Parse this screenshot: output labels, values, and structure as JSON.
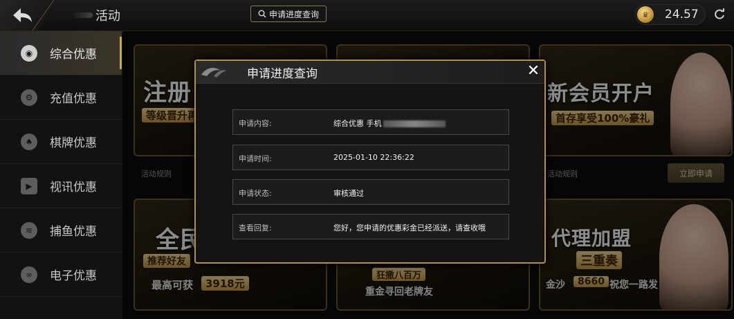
{
  "header": {
    "title": "活动",
    "query_button": "申请进度查询",
    "balance": "24.57"
  },
  "sidebar": {
    "items": [
      {
        "label": "综合优惠",
        "icon": "gift-icon",
        "active": true
      },
      {
        "label": "充值优惠",
        "icon": "recharge-icon",
        "active": false
      },
      {
        "label": "棋牌优惠",
        "icon": "cards-icon",
        "active": false
      },
      {
        "label": "视讯优惠",
        "icon": "video-icon",
        "active": false
      },
      {
        "label": "捕鱼优惠",
        "icon": "fish-icon",
        "active": false
      },
      {
        "label": "电子优惠",
        "icon": "slot-icon",
        "active": false
      }
    ]
  },
  "cards": [
    {
      "title": "注册",
      "band": "等级晋升再"
    },
    {
      "title": "",
      "band": ""
    },
    {
      "title": "新会员开户",
      "band": "首存享受100%豪礼"
    },
    {
      "title": "全民",
      "band": "推荐好友",
      "extra": "最高可获",
      "amount": "3918元"
    },
    {
      "title": "狂撒八百万",
      "band": "重金寻回老牌友"
    },
    {
      "title": "代理加盟",
      "band": "三重奏",
      "extra": "金沙",
      "amount": "8660",
      "extra2": "祝您一路发"
    }
  ],
  "rules_label": "活动规则",
  "apply_button": "立即申请",
  "modal": {
    "title": "申请进度查询",
    "rows": [
      {
        "label": "申请内容:",
        "value": "综合优惠 手机"
      },
      {
        "label": "申请时间:",
        "value": "2025-01-10 22:36:22"
      },
      {
        "label": "申请状态:",
        "value": "审核通过"
      },
      {
        "label": "查看回复:",
        "value": "您好，您申请的优惠彩金已经派送，请查收哦"
      }
    ]
  }
}
